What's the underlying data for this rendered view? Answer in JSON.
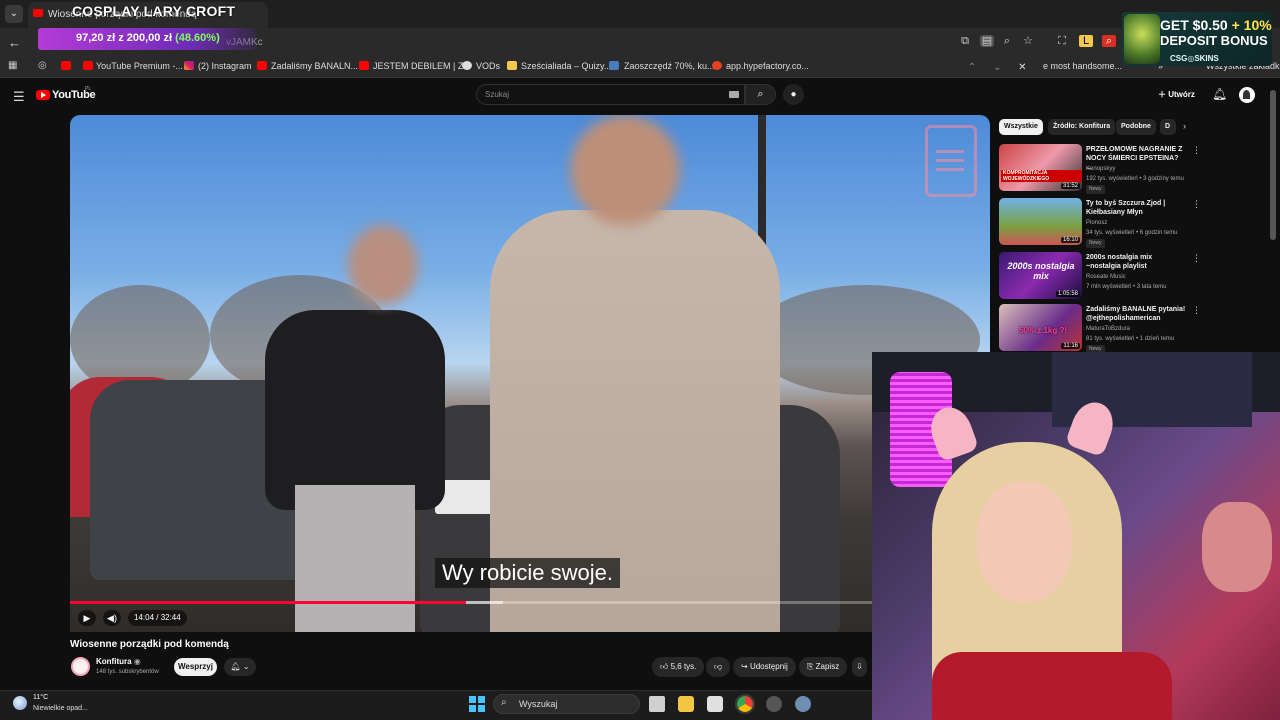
{
  "browser": {
    "tab_title": "Wiosenne porządki pod komendą",
    "url_fragment": "vJAMKc",
    "bookmarks": [
      "YouTube Premium -...",
      "(2) Instagram",
      "Zadaliśmy BANALN...",
      "JESTEM DEBILEM | Z...",
      "VODs",
      "Sześcialiada – Quizy...",
      "Zaoszczędź 70%, ku...",
      "app.hypefactory.co..."
    ],
    "bookmarks_right": "e most handsome...",
    "all_bookmarks": "Wszystkie zakładki"
  },
  "stream": {
    "title": "COSPLAY LARY CROFT",
    "donation_current": "97,20 zł",
    "donation_sep": "z",
    "donation_goal": "200,00 zł",
    "donation_percent": "(48.60%)",
    "progress_fraction": 0.486
  },
  "ad": {
    "line1_price": "GET $0.50",
    "line1_bonus": "+ 10%",
    "line2": "DEPOSIT BONUS",
    "brand": "CSG◎SKINS"
  },
  "youtube": {
    "logo": "YouTube",
    "region": "PL",
    "search_placeholder": "Szukaj",
    "create_label": "Utwórz"
  },
  "player": {
    "subtitle": "Wy robicie swoje.",
    "time": "14:04 / 32:44",
    "progress_fraction": 0.43,
    "buffer_fraction": 0.47
  },
  "video": {
    "title": "Wiosenne porządki pod komendą",
    "channel": "Konfitura",
    "subscribers": "148 tys. subskrybentów",
    "support_label": "Wesprzyj",
    "likes": "5,6 tys.",
    "share_label": "Udostępnij",
    "save_label": "Zapisz"
  },
  "sidebar": {
    "chips": [
      "Wszystkie",
      "Źródło: Konfitura",
      "Podobne",
      "D"
    ],
    "recommendations": [
      {
        "title": "PRZEŁOMOWE NAGRANIE Z NOCY ŚMIERCI EPSTEINA? ...",
        "channel": "Konopskyy",
        "meta": "192 tys. wyświetleń • 3 godziny temu",
        "badge": "Nowy",
        "duration": "31:52",
        "thumb_text": "KOMPROMITACJA WOJEWÓDZKIEGO"
      },
      {
        "title": "Ty to byś Szczura Zjod | Kiełbasiany Młyn",
        "channel": "Pionosz",
        "meta": "34 tys. wyświetleń • 6 godzin temu",
        "badge": "Nowy",
        "duration": "16:10",
        "thumb_text": ""
      },
      {
        "title": "2000s nostalgia mix ~nostalgia playlist",
        "channel": "Roseate Music",
        "meta": "7 mln wyświetleń • 3 lata temu",
        "badge": "",
        "duration": "1:05:58",
        "thumb_text": "2000s nostalgia mix"
      },
      {
        "title": "Zadaliśmy BANALNE pytania! @ejthepolishamerican",
        "channel": "MaturaToBzdura",
        "meta": "81 tys. wyświetleń • 1 dzień temu",
        "badge": "Nowy",
        "duration": "11:16",
        "thumb_text": "50% z 1kg ?!"
      }
    ]
  },
  "taskbar": {
    "temperature": "11°C",
    "weather": "Niewielkie opad...",
    "search_label": "Wyszukaj"
  },
  "colors": {
    "yt_red": "#ff0000",
    "progress_red": "#ff0033",
    "donation_purple": "#b43bd6",
    "donation_green": "#7dff5d",
    "ad_yellow": "#ffe14a"
  }
}
